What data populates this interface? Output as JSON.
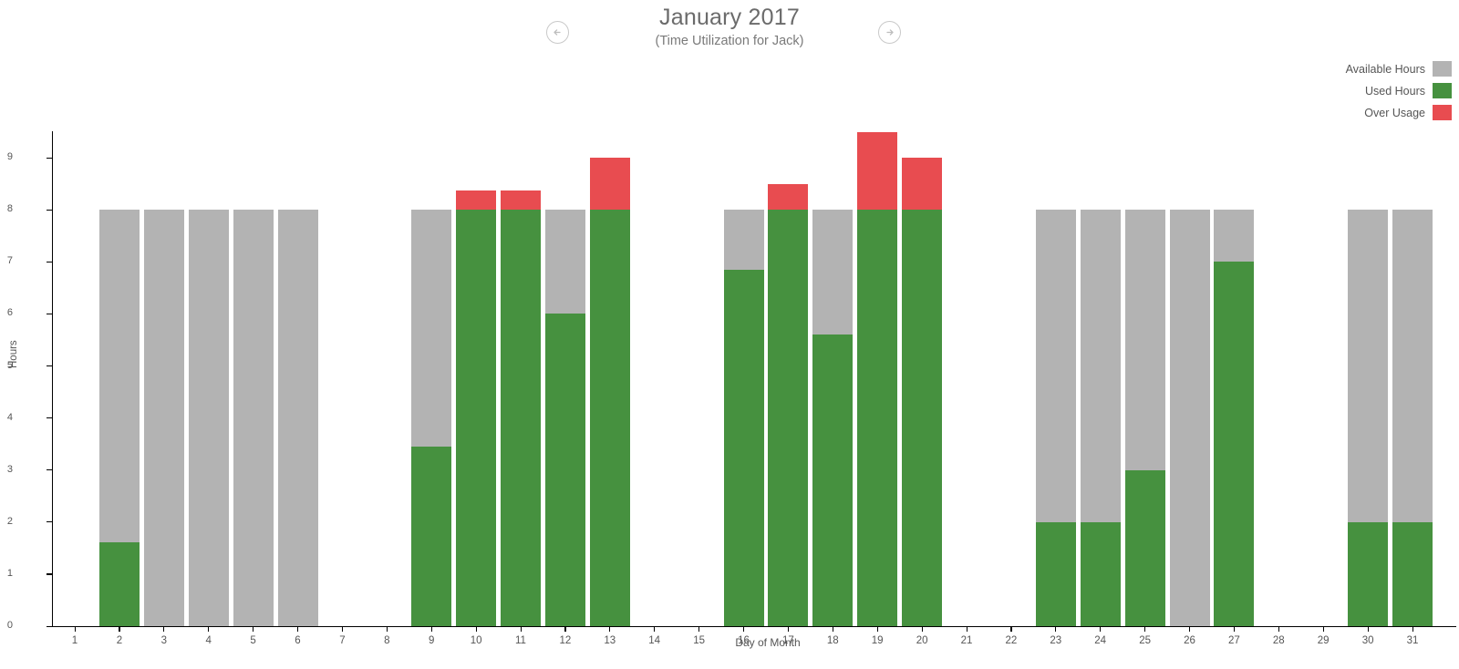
{
  "header": {
    "title": "January 2017",
    "subtitle": "(Time Utilization for Jack)",
    "prev_label": "←",
    "next_label": "→"
  },
  "legend": {
    "items": [
      {
        "label": "Available Hours",
        "color": "#b3b3b3"
      },
      {
        "label": "Used Hours",
        "color": "#46913f"
      },
      {
        "label": "Over Usage",
        "color": "#e84c50"
      }
    ]
  },
  "chart_data": {
    "type": "bar",
    "stacked": true,
    "title": "January 2017",
    "subtitle": "(Time Utilization for Jack)",
    "xlabel": "Day of Month",
    "ylabel": "Hours",
    "ylim": [
      0,
      9.5
    ],
    "yticks": [
      0,
      1,
      2,
      3,
      4,
      5,
      6,
      7,
      8,
      9
    ],
    "grid": false,
    "legend_position": "top-right",
    "categories": [
      1,
      2,
      3,
      4,
      5,
      6,
      7,
      8,
      9,
      10,
      11,
      12,
      13,
      14,
      15,
      16,
      17,
      18,
      19,
      20,
      21,
      22,
      23,
      24,
      25,
      26,
      27,
      28,
      29,
      30,
      31
    ],
    "series": [
      {
        "name": "Available Hours",
        "color": "#b3b3b3",
        "values": [
          0,
          8,
          8,
          8,
          8,
          8,
          0,
          0,
          8,
          0,
          0,
          8,
          0,
          0,
          0,
          8,
          0,
          8,
          0,
          0,
          0,
          0,
          8,
          8,
          8,
          8,
          8,
          0,
          0,
          8,
          8
        ]
      },
      {
        "name": "Used Hours",
        "color": "#46913f",
        "values": [
          0,
          1.61,
          0,
          0,
          0,
          0,
          0,
          0,
          3.45,
          8,
          8,
          6,
          8,
          0,
          0,
          6.85,
          8,
          5.6,
          8,
          8,
          0,
          0,
          2,
          2,
          3,
          0,
          7,
          0,
          0,
          2,
          2
        ]
      },
      {
        "name": "Over Usage",
        "color": "#e84c50",
        "values": [
          0,
          0,
          0,
          0,
          0,
          0,
          0,
          0,
          0,
          0.37,
          0.37,
          0,
          1,
          0,
          0,
          0,
          0.5,
          0,
          1.5,
          1,
          0,
          0,
          0,
          0,
          0,
          0,
          0,
          0,
          0,
          0,
          0
        ]
      }
    ]
  }
}
